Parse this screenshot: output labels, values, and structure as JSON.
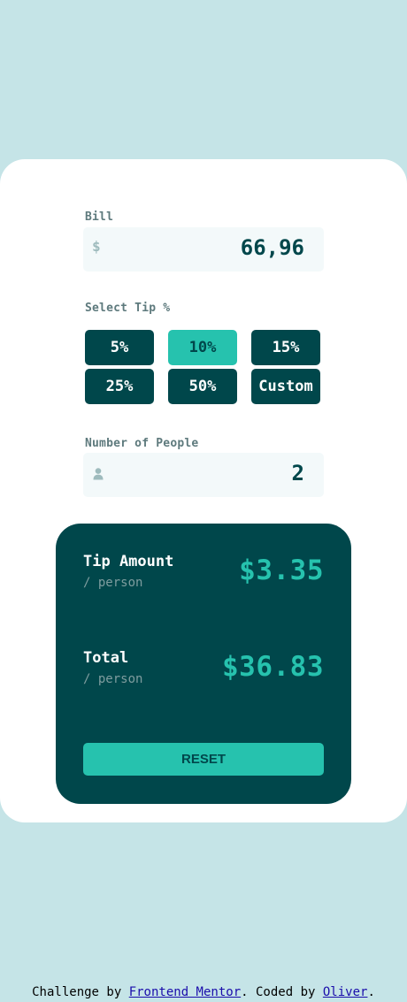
{
  "bill": {
    "label": "Bill",
    "currency_symbol": "$",
    "value": "66,96"
  },
  "tip": {
    "label": "Select Tip %",
    "options": [
      "5%",
      "10%",
      "15%",
      "25%",
      "50%"
    ],
    "custom_label": "Custom",
    "selected": "10%"
  },
  "people": {
    "label": "Number of People",
    "icon": "person-icon",
    "value": "2"
  },
  "summary": {
    "tip_title": "Tip Amount",
    "tip_sub": "/ person",
    "tip_value": "$3.35",
    "total_title": "Total",
    "total_sub": "/ person",
    "total_value": "$36.83",
    "reset_label": "RESET"
  },
  "footer": {
    "prefix": "Challenge by ",
    "link1": "Frontend Mentor",
    "middle": ". Coded by ",
    "link2": "Oliver",
    "suffix": "."
  },
  "colors": {
    "background": "#c5e4e7",
    "dark_cyan": "#00474b",
    "strong_cyan": "#26c2ae",
    "input_bg": "#f3f9fa"
  }
}
